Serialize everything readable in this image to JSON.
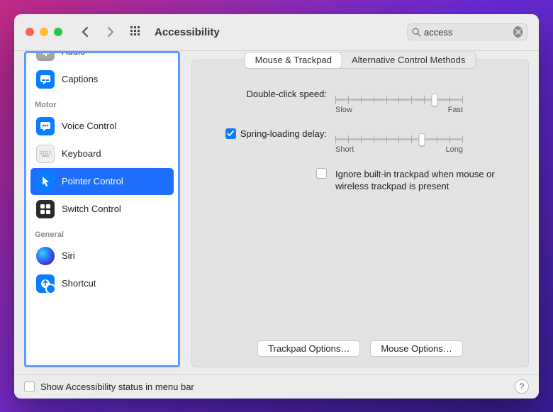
{
  "header": {
    "title": "Accessibility",
    "search_value": "access"
  },
  "sidebar": {
    "sections": [
      {
        "head": "",
        "items": [
          {
            "label": "Audio",
            "icon": "audio"
          },
          {
            "label": "Captions",
            "icon": "captions"
          }
        ]
      },
      {
        "head": "Motor",
        "items": [
          {
            "label": "Voice Control",
            "icon": "voice"
          },
          {
            "label": "Keyboard",
            "icon": "keyboard"
          },
          {
            "label": "Pointer Control",
            "icon": "pointer",
            "selected": true
          },
          {
            "label": "Switch Control",
            "icon": "switch"
          }
        ]
      },
      {
        "head": "General",
        "items": [
          {
            "label": "Siri",
            "icon": "siri"
          },
          {
            "label": "Shortcut",
            "icon": "shortcut"
          }
        ]
      }
    ]
  },
  "tabs": {
    "items": [
      {
        "label": "Mouse & Trackpad",
        "active": true
      },
      {
        "label": "Alternative Control Methods",
        "active": false
      }
    ]
  },
  "form": {
    "double_click": {
      "label": "Double-click speed:",
      "min_label": "Slow",
      "max_label": "Fast",
      "value_pct": 78
    },
    "spring": {
      "checked": true,
      "label": "Spring-loading delay:",
      "min_label": "Short",
      "max_label": "Long",
      "value_pct": 68
    },
    "ignore_trackpad": {
      "checked": false,
      "label": "Ignore built-in trackpad when mouse or wireless trackpad is present"
    },
    "trackpad_options_btn": "Trackpad Options…",
    "mouse_options_btn": "Mouse Options…"
  },
  "footer": {
    "show_status_label": "Show Accessibility status in menu bar",
    "show_status_checked": false,
    "help_label": "?"
  }
}
